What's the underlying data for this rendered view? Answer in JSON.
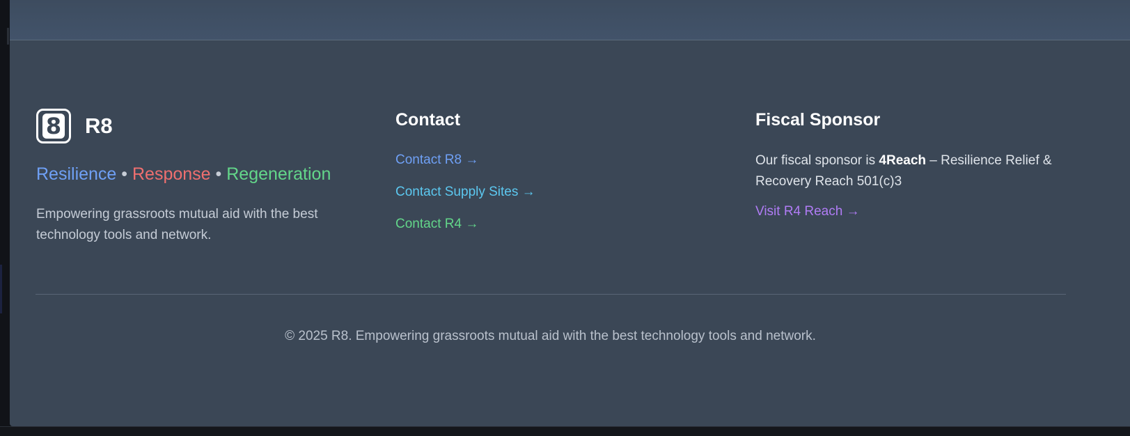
{
  "brand": {
    "logo_glyph": "8",
    "name": "R8",
    "tagline": {
      "word1": "Resilience",
      "sep1": " • ",
      "word2": "Response",
      "sep2": " • ",
      "word3": "Regeneration"
    },
    "description": "Empowering grassroots mutual aid with the best technology tools and network."
  },
  "contact": {
    "heading": "Contact",
    "links": [
      {
        "label": "Contact R8 →",
        "color": "#6fa0f5"
      },
      {
        "label": "Contact Supply Sites →",
        "color": "#5cc8f0"
      },
      {
        "label": "Contact R4 →",
        "color": "#63d68a"
      }
    ]
  },
  "sponsor": {
    "heading": "Fiscal Sponsor",
    "text_prefix": "Our fiscal sponsor is ",
    "sponsor_name": "4Reach",
    "text_suffix": " – Resilience Relief & Recovery Reach 501(c)3",
    "link_label": "Visit R4 Reach →",
    "link_color": "#b07cf5"
  },
  "footer": {
    "copyright": "© 2025 R8. Empowering grassroots mutual aid with the best technology tools and network."
  },
  "colors": {
    "background": "#3b4756",
    "resilience": "#6fa0f5",
    "response": "#ef6f6f",
    "regeneration": "#63d68a"
  }
}
